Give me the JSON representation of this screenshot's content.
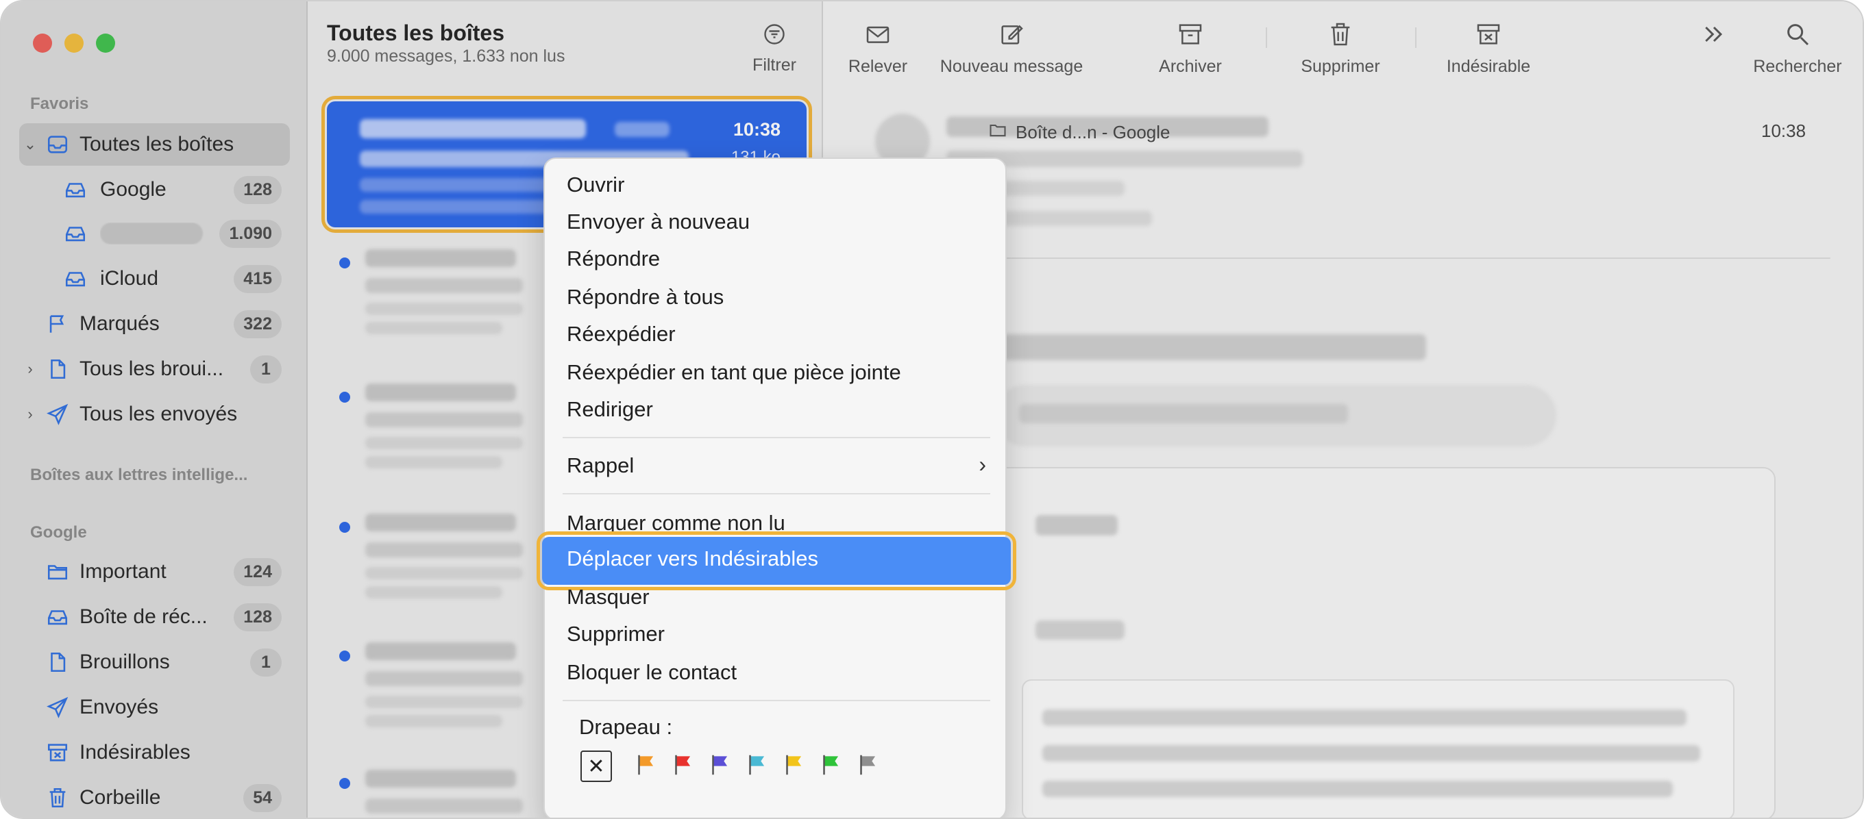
{
  "sidebar": {
    "favorites_label": "Favoris",
    "smart_label": "Boîtes aux lettres intellige...",
    "google_label": "Google",
    "favorites": [
      {
        "label": "Toutes les boîtes",
        "icon": "tray-icon",
        "badge": "",
        "active": true
      },
      {
        "label": "Google",
        "icon": "tray-icon",
        "badge": "128"
      },
      {
        "label": "",
        "icon": "tray-icon",
        "badge": "1.090",
        "redacted": true
      },
      {
        "label": "iCloud",
        "icon": "tray-icon",
        "badge": "415"
      },
      {
        "label": "Marqués",
        "icon": "flag-icon",
        "badge": "322"
      },
      {
        "label": "Tous les broui...",
        "icon": "document-icon",
        "badge": "1"
      },
      {
        "label": "Tous les envoyés",
        "icon": "send-icon",
        "badge": ""
      }
    ],
    "google_items": [
      {
        "label": "Important",
        "icon": "folder-icon",
        "badge": "124"
      },
      {
        "label": "Boîte de réc...",
        "icon": "tray-icon",
        "badge": "128"
      },
      {
        "label": "Brouillons",
        "icon": "document-icon",
        "badge": "1"
      },
      {
        "label": "Envoyés",
        "icon": "send-icon",
        "badge": ""
      },
      {
        "label": "Indésirables",
        "icon": "junk-icon",
        "badge": ""
      },
      {
        "label": "Corbeille",
        "icon": "trash-icon",
        "badge": "54"
      }
    ]
  },
  "list": {
    "title": "Toutes les boîtes",
    "subtitle": "9.000 messages, 1.633 non lus",
    "filter_label": "Filtrer",
    "selected_time": "10:38",
    "selected_size": "131 ko"
  },
  "toolbar": {
    "relever": "Relever",
    "nouveau": "Nouveau message",
    "archiver": "Archiver",
    "supprimer": "Supprimer",
    "indesirable": "Indésirable",
    "rechercher": "Rechercher"
  },
  "reader": {
    "mailbox": "Boîte d...n - Google",
    "time": "10:38"
  },
  "menu": {
    "items": [
      "Ouvrir",
      "Envoyer à nouveau",
      "Répondre",
      "Répondre à tous",
      "Réexpédier",
      "Réexpédier en tant que pièce jointe",
      "Rediriger"
    ],
    "rappel": "Rappel",
    "marquer": "Marquer comme non lu",
    "deplacer": "Déplacer vers Indésirables",
    "lower_items": [
      "Masquer",
      "Supprimer",
      "Bloquer le contact"
    ],
    "flag_label": "Drapeau :",
    "flag_colors": [
      "#f39a2a",
      "#e8322e",
      "#5b4fd6",
      "#4ab9d4",
      "#f2c41a",
      "#2fc33a",
      "#8f8f8f"
    ]
  },
  "colors": {
    "accent": "#2b66e8",
    "highlight": "#4a8df6",
    "annotation": "#f0b43a"
  }
}
